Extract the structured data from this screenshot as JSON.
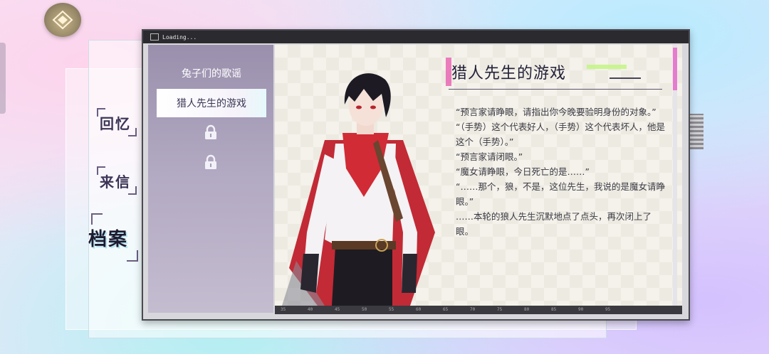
{
  "window": {
    "title": "Loading..."
  },
  "nav": {
    "memory": "回忆",
    "letter": "来信",
    "archive": "档案"
  },
  "sidebar": {
    "items": [
      {
        "label": "兔子们的歌谣",
        "selected": false,
        "locked": false
      },
      {
        "label": "猎人先生的游戏",
        "selected": true,
        "locked": false
      },
      {
        "label": "",
        "locked": true
      },
      {
        "label": "",
        "locked": true
      }
    ]
  },
  "story": {
    "title": "猎人先生的游戏",
    "lines": [
      "“预言家请睁眼，请指出你今晚要验明身份的对象。”",
      "“（手势）这个代表好人，（手势）这个代表坏人，他是这个（手势）。”",
      "“预言家请闭眼。”",
      "“魔女请睁眼，今日死亡的是……”",
      "“……那个，狼，不是，这位先生，我说的是魔女请睁眼。”",
      "……本轮的狼人先生沉默地点了点头，再次闭上了眼。"
    ]
  },
  "ruler": {
    "ticks": [
      "35",
      "40",
      "45",
      "50",
      "55",
      "60",
      "65",
      "70",
      "75",
      "80",
      "85",
      "90",
      "95"
    ]
  },
  "colors": {
    "accent_pink": "#e67cd0",
    "accent_green": "#c6f58a",
    "sidebar": "#9a90ad"
  }
}
